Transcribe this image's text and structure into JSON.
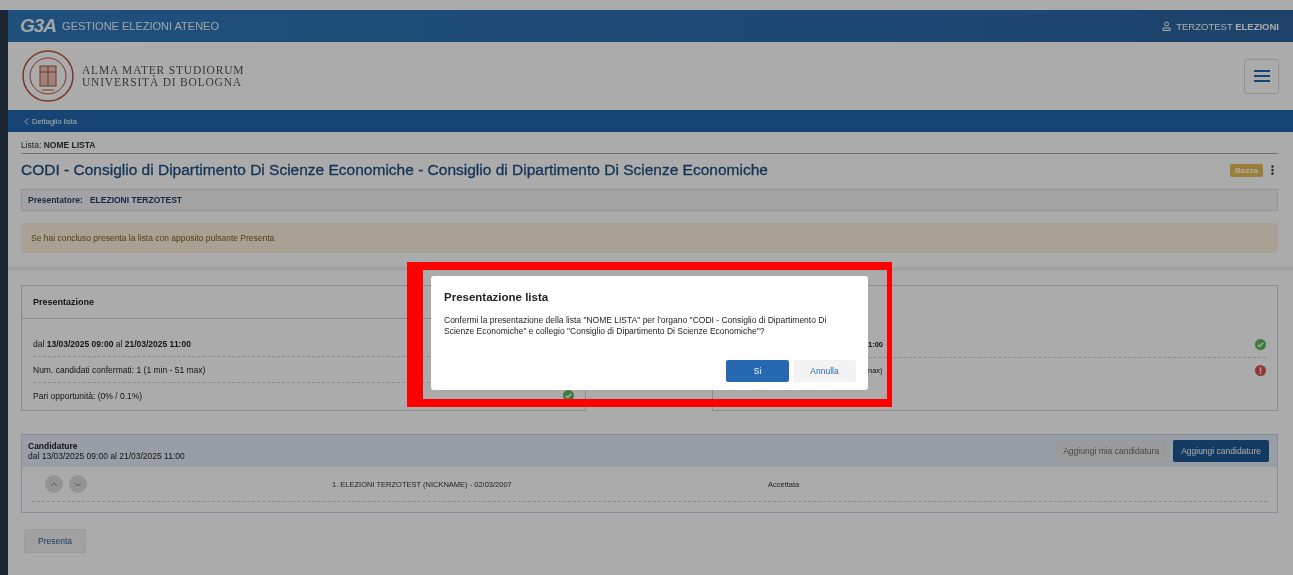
{
  "app_bar": {
    "logo": "G3A",
    "title": "GESTIONE ELEZIONI ATENEO",
    "user_first": "TERZOTEST",
    "user_last": "ELEZIONI"
  },
  "university": {
    "line1": "ALMA MATER STUDIORUM",
    "line2": "UNIVERSITÀ DI BOLOGNA"
  },
  "breadcrumb": {
    "label": "Dettaglio lista"
  },
  "list": {
    "label": "Lista:",
    "name": "NOME LISTA",
    "title": "CODI - Consiglio di Dipartimento Di Scienze Economiche - Consiglio di Dipartimento Di Scienze Economiche",
    "status": "Bozza",
    "presenter_label": "Presentatore:",
    "presenter": "ELEZIONI TERZOTEST"
  },
  "alert": "Se hai concluso presenta la lista con apposito pulsante Presenta",
  "cards": [
    {
      "title": "Presentazione",
      "rows": [
        {
          "text": "dal **13/03/2025 09:00** al **21/03/2025 11:00**",
          "bold": false
        },
        {
          "text": "Num. candidati confermati: 1 (1 min - 51 max)",
          "bold": false
        },
        {
          "text": "Pari opportunità: (0% / 0.1%)",
          "bold": false,
          "valid": true
        }
      ]
    },
    {
      "rows": [
        {
          "text": "1:00",
          "bold": true,
          "valid": true
        },
        {
          "text": "nax)",
          "bold": false,
          "valid": false
        }
      ]
    }
  ],
  "candidature": {
    "title": "Candidature",
    "period": "dal 13/03/2025 09:00 al 21/03/2025 11:00",
    "actions": [
      {
        "label": "Aggiungi mia candidatura",
        "disabled": true
      },
      {
        "label": "Aggiungi candidature",
        "disabled": false
      }
    ],
    "rows": [
      {
        "name": "1. ELEZIONI TERZOTEST (NICKNAME) - 02/03/2007",
        "status": "Accettata"
      }
    ]
  },
  "footer_button": "Presenta",
  "modal": {
    "title": "Presentazione lista",
    "message": "Confermi la presentazione della lista \"NOME LISTA\" per l'organo \"CODI - Consiglio di Dipartimento Di Scienze Economiche\" e collegio \"Consiglio di Dipartimento Di Scienze Economiche\"?",
    "buttons": [
      {
        "label": "Si",
        "primary": true
      },
      {
        "label": "Annulla",
        "primary": false
      }
    ]
  }
}
